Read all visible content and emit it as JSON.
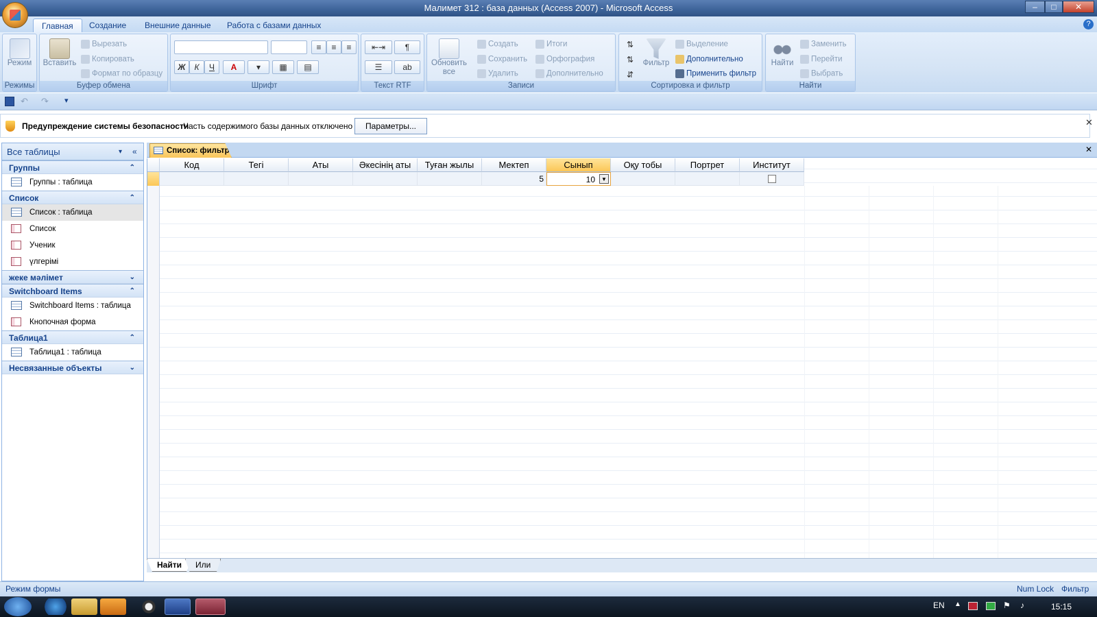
{
  "window": {
    "title": "Малимет 312 : база данных (Access 2007) - Microsoft Access",
    "min": "–",
    "max": "□",
    "close": "✕"
  },
  "tabs": [
    "Главная",
    "Создание",
    "Внешние данные",
    "Работа с базами данных"
  ],
  "ribbon": {
    "modes": {
      "view": "Режим",
      "group": "Режимы"
    },
    "clipboard": {
      "paste": "Вставить",
      "cut": "Вырезать",
      "copy": "Копировать",
      "format_painter": "Формат по образцу",
      "group": "Буфер обмена"
    },
    "font": {
      "bold": "Ж",
      "italic": "К",
      "underline": "Ч",
      "font_color": "A",
      "group": "Шрифт"
    },
    "rtf": {
      "group": "Текст RTF"
    },
    "records": {
      "refresh": "Обновить все",
      "new": "Создать",
      "save": "Сохранить",
      "delete": "Удалить",
      "totals": "Итоги",
      "spelling": "Орфография",
      "more": "Дополнительно",
      "group": "Записи"
    },
    "sort": {
      "filter": "Фильтр",
      "selection": "Выделение",
      "advanced": "Дополнительно",
      "apply": "Применить фильтр",
      "group": "Сортировка и фильтр"
    },
    "find": {
      "find": "Найти",
      "replace": "Заменить",
      "goto": "Перейти",
      "select": "Выбрать",
      "group": "Найти"
    }
  },
  "security": {
    "title": "Предупреждение системы безопасности",
    "text": "Часть содержимого базы данных отключено",
    "button": "Параметры..."
  },
  "nav": {
    "header": "Все таблицы",
    "groups": [
      {
        "name": "Группы",
        "chev": "⌃",
        "items": [
          {
            "label": "Группы : таблица",
            "type": "table"
          }
        ]
      },
      {
        "name": "Список",
        "chev": "⌃",
        "items": [
          {
            "label": "Список : таблица",
            "type": "table",
            "selected": true
          },
          {
            "label": "Список",
            "type": "form"
          },
          {
            "label": "Ученик",
            "type": "form"
          },
          {
            "label": "үлгерімі",
            "type": "form"
          }
        ]
      },
      {
        "name": "жеке мәлімет",
        "chev": "⌄",
        "items": []
      },
      {
        "name": "Switchboard Items",
        "chev": "⌃",
        "items": [
          {
            "label": "Switchboard Items : таблица",
            "type": "table"
          },
          {
            "label": "Кнопочная форма",
            "type": "form"
          }
        ]
      },
      {
        "name": "Таблица1",
        "chev": "⌃",
        "items": [
          {
            "label": "Таблица1 : таблица",
            "type": "table"
          }
        ]
      },
      {
        "name": "Несвязанные объекты",
        "chev": "⌄",
        "items": []
      }
    ]
  },
  "document": {
    "tab": "Список: фильтр",
    "close": "✕"
  },
  "grid": {
    "columns": [
      "Код",
      "Тегі",
      "Аты",
      "Әкесінің аты",
      "Туған жылы",
      "Мектеп",
      "Сынып",
      "Оқу тобы",
      "Портрет",
      "Институт"
    ],
    "row": [
      "",
      "",
      "",
      "",
      "",
      "5",
      "10",
      "",
      "",
      ""
    ],
    "active_column": "Сынып"
  },
  "form_tabs": [
    "Найти",
    "Или"
  ],
  "status": {
    "left": "Режим формы",
    "numlock": "Num Lock",
    "filter": "Фильтр"
  },
  "taskbar": {
    "lang": "EN",
    "time": "15:15"
  }
}
